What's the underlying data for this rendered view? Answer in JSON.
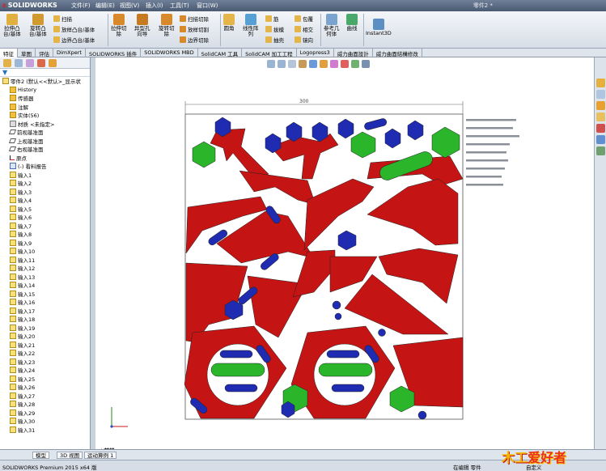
{
  "app": {
    "name": "SOLIDWORKS",
    "doc_title": "零件2 *",
    "menus": [
      "文件(F)",
      "编辑(E)",
      "视图(V)",
      "插入(I)",
      "工具(T)",
      "窗口(W)"
    ]
  },
  "ribbon": {
    "boss_extrude": "拉伸凸\n台/基体",
    "revolve_boss": "旋转凸\n台/基体",
    "sweep": "扫描",
    "loft": "放样凸台/基体",
    "boundary": "边界凸台/基体",
    "extrude_cut": "拉伸切\n除",
    "hole_wizard": "异型孔\n向导",
    "revolve_cut": "旋转切\n除",
    "sweep_cut": "扫描切除",
    "loft_cut": "放样切割",
    "boundary_cut": "边界切除",
    "fillet": "圆角",
    "linear_pattern": "线性阵\n列",
    "rib": "筋",
    "draft": "拔模",
    "shell": "抽壳",
    "wrap": "包覆",
    "intersect": "相交",
    "mirror": "镜向",
    "ref_geometry": "参考几\n何体",
    "curves": "曲线",
    "instant3d": "Instant3D"
  },
  "tabs": [
    "特征",
    "草图",
    "评估",
    "DimXpert",
    "SOLIDWORKS 插件",
    "SOLIDWORKS MBD",
    "SolidCAM 工具",
    "SolidCAM 加工工程",
    "Logopress3",
    "威力曲面設計",
    "威力曲面結構修改"
  ],
  "tree": {
    "root": "零件2 (默认<<默认>_显示状",
    "items": [
      "History",
      "传感器",
      "注解",
      "实体(56)",
      "材质 <未指定>",
      "前视基准面",
      "上视基准面",
      "右视基准面",
      "原点",
      "(-) 看料报告"
    ],
    "sketches": [
      "输入1",
      "输入2",
      "输入3",
      "输入4",
      "输入5",
      "输入6",
      "输入7",
      "输入8",
      "输入9",
      "输入10",
      "输入11",
      "输入12",
      "输入13",
      "输入14",
      "输入15",
      "输入16",
      "输入17",
      "输入18",
      "输入19",
      "输入20",
      "输入21",
      "输入22",
      "输入23",
      "输入24",
      "输入25",
      "输入26",
      "输入27",
      "输入28",
      "输入29",
      "输入30",
      "输入31"
    ]
  },
  "drawing": {
    "dimension": "300",
    "view_label": "*前视"
  },
  "bottom_tabs": [
    "模型",
    "3D 视图",
    "运动算例 1"
  ],
  "status": {
    "version": "SOLIDWORKS Premium 2015 x64 版",
    "mode": "在编辑 零件",
    "custom": "自定义"
  },
  "watermark": {
    "a": "木工",
    "b": "爱好者"
  },
  "colors": {
    "red": "#c41414",
    "blue": "#1f2bb0",
    "green": "#2ab52a"
  }
}
